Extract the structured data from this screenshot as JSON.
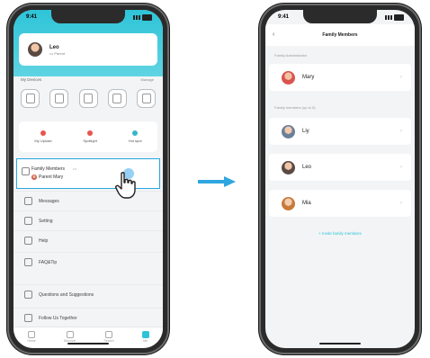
{
  "left_phone": {
    "status_time": "9:41",
    "profile": {
      "name": "Leo",
      "subtitle": "••• Parent"
    },
    "devices_section": {
      "label": "My Devices",
      "more": "Manage"
    },
    "actions": [
      {
        "label": "My Upload",
        "color": "#e8544e"
      },
      {
        "label": "Spotlight",
        "color": "#e8544e"
      },
      {
        "label": "Hot spot",
        "color": "#35b6c9"
      }
    ],
    "family_card": {
      "title": "Family Members",
      "badge": "•••",
      "sub": "Parent Mary"
    },
    "menu": [
      {
        "label": "Messages"
      },
      {
        "label": "Setting"
      },
      {
        "label": "Help"
      },
      {
        "label": "FAQ&Tip"
      },
      {
        "label": "Questions and Suggestions"
      },
      {
        "label": "Follow Us Together"
      }
    ],
    "tabs": [
      {
        "label": "Home"
      },
      {
        "label": "Discover"
      },
      {
        "label": "Search"
      },
      {
        "label": "Me",
        "active": true
      }
    ]
  },
  "right_phone": {
    "status_time": "9:41",
    "title": "Family Members",
    "admin_section": "Family Administrator",
    "members_section": "Family members (up to 5)",
    "admin": {
      "name": "Mary",
      "avatar_color": "#d9534f"
    },
    "members": [
      {
        "name": "Liy",
        "avatar_color": "#6b7f99"
      },
      {
        "name": "Leo",
        "avatar_color": "#5a4a42"
      },
      {
        "name": "Mia",
        "avatar_color": "#c77a3a"
      }
    ],
    "add_label": "+ Invite family members"
  },
  "arrow_color": "#2ea6df"
}
